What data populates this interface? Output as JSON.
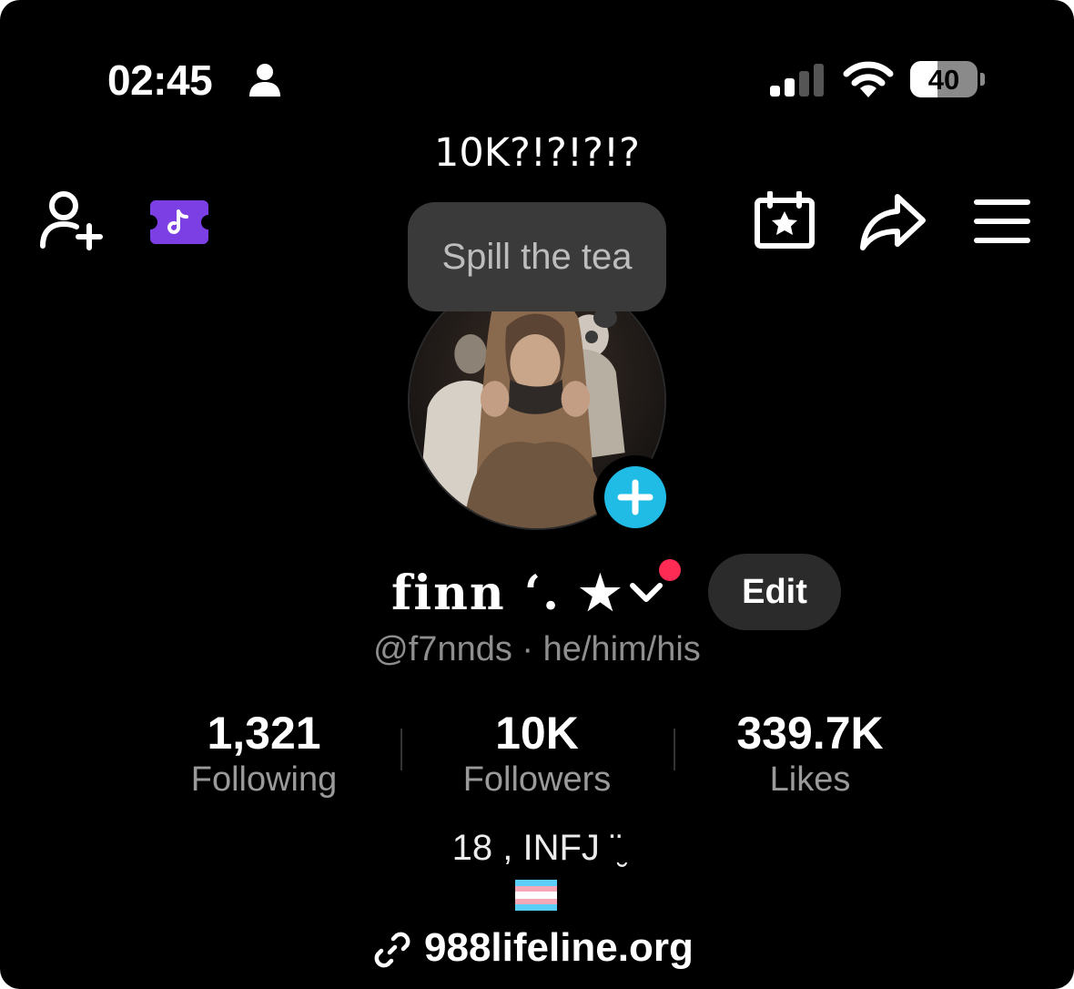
{
  "status_bar": {
    "time": "02:45",
    "battery_level": "40",
    "battery_fraction": 0.4
  },
  "caption": "10K?!?!?!?",
  "thought_bubble": "Spill the tea",
  "profile": {
    "display_name": "finn ‘. ★",
    "handle_pronouns": "@f7nnds · he/him/his",
    "edit_label": "Edit"
  },
  "stats": [
    {
      "value": "1,321",
      "label": "Following"
    },
    {
      "value": "10K",
      "label": "Followers"
    },
    {
      "value": "339.7K",
      "label": "Likes"
    }
  ],
  "bio": {
    "line1": "18 , INFJ ¨̮",
    "link": "988lifeline.org"
  },
  "colors": {
    "background": "#000000",
    "accent_blue": "#21bce6",
    "notification_red": "#fe2c55",
    "ticket_purple": "#7b3fe4",
    "trans_blue": "#5bcefa",
    "trans_pink": "#f5a9b8"
  },
  "icons": [
    "person-icon",
    "cellular-signal-icon",
    "wifi-icon",
    "add-friend-icon",
    "ticket-icon",
    "calendar-star-icon",
    "share-icon",
    "menu-icon",
    "plus-icon",
    "chevron-down-icon",
    "trans-flag-icon",
    "link-icon"
  ]
}
